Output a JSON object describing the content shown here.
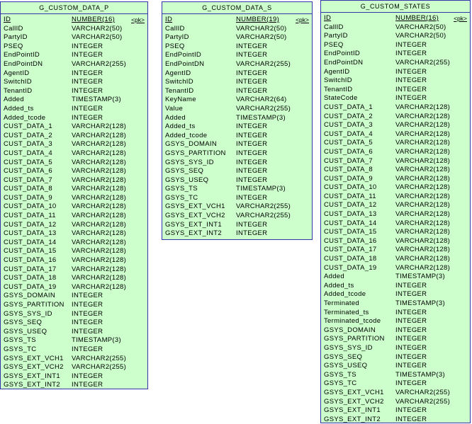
{
  "entities": [
    {
      "id": "e1",
      "title": "G_CUSTOM_DATA_P",
      "columns": [
        {
          "name": "ID",
          "type": "NUMBER(16)",
          "key": "<pk>"
        },
        {
          "name": "CallID",
          "type": "VARCHAR2(50)"
        },
        {
          "name": "PartyID",
          "type": "VARCHAR2(50)"
        },
        {
          "name": "PSEQ",
          "type": "INTEGER"
        },
        {
          "name": "EndPointID",
          "type": "INTEGER"
        },
        {
          "name": "EndPointDN",
          "type": "VARCHAR2(255)"
        },
        {
          "name": "AgentID",
          "type": "INTEGER"
        },
        {
          "name": "SwitchID",
          "type": "INTEGER"
        },
        {
          "name": "TenantID",
          "type": "INTEGER"
        },
        {
          "name": "Added",
          "type": "TIMESTAMP(3)"
        },
        {
          "name": "Added_ts",
          "type": "INTEGER"
        },
        {
          "name": "Added_tcode",
          "type": "INTEGER"
        },
        {
          "name": "CUST_DATA_1",
          "type": "VARCHAR2(128)"
        },
        {
          "name": "CUST_DATA_2",
          "type": "VARCHAR2(128)"
        },
        {
          "name": "CUST_DATA_3",
          "type": "VARCHAR2(128)"
        },
        {
          "name": "CUST_DATA_4",
          "type": "VARCHAR2(128)"
        },
        {
          "name": "CUST_DATA_5",
          "type": "VARCHAR2(128)"
        },
        {
          "name": "CUST_DATA_6",
          "type": "VARCHAR2(128)"
        },
        {
          "name": "CUST_DATA_7",
          "type": "VARCHAR2(128)"
        },
        {
          "name": "CUST_DATA_8",
          "type": "VARCHAR2(128)"
        },
        {
          "name": "CUST_DATA_9",
          "type": "VARCHAR2(128)"
        },
        {
          "name": "CUST_DATA_10",
          "type": "VARCHAR2(128)"
        },
        {
          "name": "CUST_DATA_11",
          "type": "VARCHAR2(128)"
        },
        {
          "name": "CUST_DATA_12",
          "type": "VARCHAR2(128)"
        },
        {
          "name": "CUST_DATA_13",
          "type": "VARCHAR2(128)"
        },
        {
          "name": "CUST_DATA_14",
          "type": "VARCHAR2(128)"
        },
        {
          "name": "CUST_DATA_15",
          "type": "VARCHAR2(128)"
        },
        {
          "name": "CUST_DATA_16",
          "type": "VARCHAR2(128)"
        },
        {
          "name": "CUST_DATA_17",
          "type": "VARCHAR2(128)"
        },
        {
          "name": "CUST_DATA_18",
          "type": "VARCHAR2(128)"
        },
        {
          "name": "CUST_DATA_19",
          "type": "VARCHAR2(128)"
        },
        {
          "name": "GSYS_DOMAIN",
          "type": "INTEGER"
        },
        {
          "name": "GSYS_PARTITION",
          "type": "INTEGER"
        },
        {
          "name": "GSYS_SYS_ID",
          "type": "INTEGER"
        },
        {
          "name": "GSYS_SEQ",
          "type": "INTEGER"
        },
        {
          "name": "GSYS_USEQ",
          "type": "INTEGER"
        },
        {
          "name": "GSYS_TS",
          "type": "TIMESTAMP(3)"
        },
        {
          "name": "GSYS_TC",
          "type": "INTEGER"
        },
        {
          "name": "GSYS_EXT_VCH1",
          "type": "VARCHAR2(255)"
        },
        {
          "name": "GSYS_EXT_VCH2",
          "type": "VARCHAR2(255)"
        },
        {
          "name": "GSYS_EXT_INT1",
          "type": "INTEGER"
        },
        {
          "name": "GSYS_EXT_INT2",
          "type": "INTEGER"
        }
      ]
    },
    {
      "id": "e2",
      "title": "G_CUSTOM_DATA_S",
      "columns": [
        {
          "name": "ID",
          "type": "NUMBER(19)",
          "key": "<pk>"
        },
        {
          "name": "CallID",
          "type": "VARCHAR2(50)"
        },
        {
          "name": "PartyID",
          "type": "VARCHAR2(50)"
        },
        {
          "name": "PSEQ",
          "type": "INTEGER"
        },
        {
          "name": "EndPointID",
          "type": "INTEGER"
        },
        {
          "name": "EndPointDN",
          "type": "VARCHAR2(255)"
        },
        {
          "name": "AgentID",
          "type": "INTEGER"
        },
        {
          "name": "SwitchID",
          "type": "INTEGER"
        },
        {
          "name": "TenantID",
          "type": "INTEGER"
        },
        {
          "name": "KeyName",
          "type": "VARCHAR2(64)"
        },
        {
          "name": "Value",
          "type": "VARCHAR2(255)"
        },
        {
          "name": "Added",
          "type": "TIMESTAMP(3)"
        },
        {
          "name": "Added_ts",
          "type": "INTEGER"
        },
        {
          "name": "Added_tcode",
          "type": "INTEGER"
        },
        {
          "name": "GSYS_DOMAIN",
          "type": "INTEGER"
        },
        {
          "name": "GSYS_PARTITION",
          "type": "INTEGER"
        },
        {
          "name": "GSYS_SYS_ID",
          "type": "INTEGER"
        },
        {
          "name": "GSYS_SEQ",
          "type": "INTEGER"
        },
        {
          "name": "GSYS_USEQ",
          "type": "INTEGER"
        },
        {
          "name": "GSYS_TS",
          "type": "TIMESTAMP(3)"
        },
        {
          "name": "GSYS_TC",
          "type": "INTEGER"
        },
        {
          "name": "GSYS_EXT_VCH1",
          "type": "VARCHAR2(255)"
        },
        {
          "name": "GSYS_EXT_VCH2",
          "type": "VARCHAR2(255)"
        },
        {
          "name": "GSYS_EXT_INT1",
          "type": "INTEGER"
        },
        {
          "name": "GSYS_EXT_INT2",
          "type": "INTEGER"
        }
      ]
    },
    {
      "id": "e3",
      "title": "G_CUSTOM_STATES",
      "columns": [
        {
          "name": "ID",
          "type": "NUMBER(16)",
          "key": "<pk>"
        },
        {
          "name": "CallID",
          "type": "VARCHAR2(50)"
        },
        {
          "name": "PartyID",
          "type": "VARCHAR2(50)"
        },
        {
          "name": "PSEQ",
          "type": "INTEGER"
        },
        {
          "name": "EndPointID",
          "type": "INTEGER"
        },
        {
          "name": "EndPointDN",
          "type": "VARCHAR2(255)"
        },
        {
          "name": "AgentID",
          "type": "INTEGER"
        },
        {
          "name": "SwitchID",
          "type": "INTEGER"
        },
        {
          "name": "TenantID",
          "type": "INTEGER"
        },
        {
          "name": "StateCode",
          "type": "INTEGER"
        },
        {
          "name": "CUST_DATA_1",
          "type": "VARCHAR2(128)"
        },
        {
          "name": "CUST_DATA_2",
          "type": "VARCHAR2(128)"
        },
        {
          "name": "CUST_DATA_3",
          "type": "VARCHAR2(128)"
        },
        {
          "name": "CUST_DATA_4",
          "type": "VARCHAR2(128)"
        },
        {
          "name": "CUST_DATA_5",
          "type": "VARCHAR2(128)"
        },
        {
          "name": "CUST_DATA_6",
          "type": "VARCHAR2(128)"
        },
        {
          "name": "CUST_DATA_7",
          "type": "VARCHAR2(128)"
        },
        {
          "name": "CUST_DATA_8",
          "type": "VARCHAR2(128)"
        },
        {
          "name": "CUST_DATA_9",
          "type": "VARCHAR2(128)"
        },
        {
          "name": "CUST_DATA_10",
          "type": "VARCHAR2(128)"
        },
        {
          "name": "CUST_DATA_11",
          "type": "VARCHAR2(128)"
        },
        {
          "name": "CUST_DATA_12",
          "type": "VARCHAR2(128)"
        },
        {
          "name": "CUST_DATA_13",
          "type": "VARCHAR2(128)"
        },
        {
          "name": "CUST_DATA_14",
          "type": "VARCHAR2(128)"
        },
        {
          "name": "CUST_DATA_15",
          "type": "VARCHAR2(128)"
        },
        {
          "name": "CUST_DATA_16",
          "type": "VARCHAR2(128)"
        },
        {
          "name": "CUST_DATA_17",
          "type": "VARCHAR2(128)"
        },
        {
          "name": "CUST_DATA_18",
          "type": "VARCHAR2(128)"
        },
        {
          "name": "CUST_DATA_19",
          "type": "VARCHAR2(128)"
        },
        {
          "name": "Added",
          "type": "TIMESTAMP(3)"
        },
        {
          "name": "Added_ts",
          "type": "INTEGER"
        },
        {
          "name": "Added_tcode",
          "type": "INTEGER"
        },
        {
          "name": "Terminated",
          "type": "TIMESTAMP(3)"
        },
        {
          "name": "Terminated_ts",
          "type": "INTEGER"
        },
        {
          "name": "Terminated_tcode",
          "type": "INTEGER"
        },
        {
          "name": "GSYS_DOMAIN",
          "type": "INTEGER"
        },
        {
          "name": "GSYS_PARTITION",
          "type": "INTEGER"
        },
        {
          "name": "GSYS_SYS_ID",
          "type": "INTEGER"
        },
        {
          "name": "GSYS_SEQ",
          "type": "INTEGER"
        },
        {
          "name": "GSYS_USEQ",
          "type": "INTEGER"
        },
        {
          "name": "GSYS_TS",
          "type": "TIMESTAMP(3)"
        },
        {
          "name": "GSYS_TC",
          "type": "INTEGER"
        },
        {
          "name": "GSYS_EXT_VCH1",
          "type": "VARCHAR2(255)"
        },
        {
          "name": "GSYS_EXT_VCH2",
          "type": "VARCHAR2(255)"
        },
        {
          "name": "GSYS_EXT_INT1",
          "type": "INTEGER"
        },
        {
          "name": "GSYS_EXT_INT2",
          "type": "INTEGER"
        }
      ]
    }
  ]
}
